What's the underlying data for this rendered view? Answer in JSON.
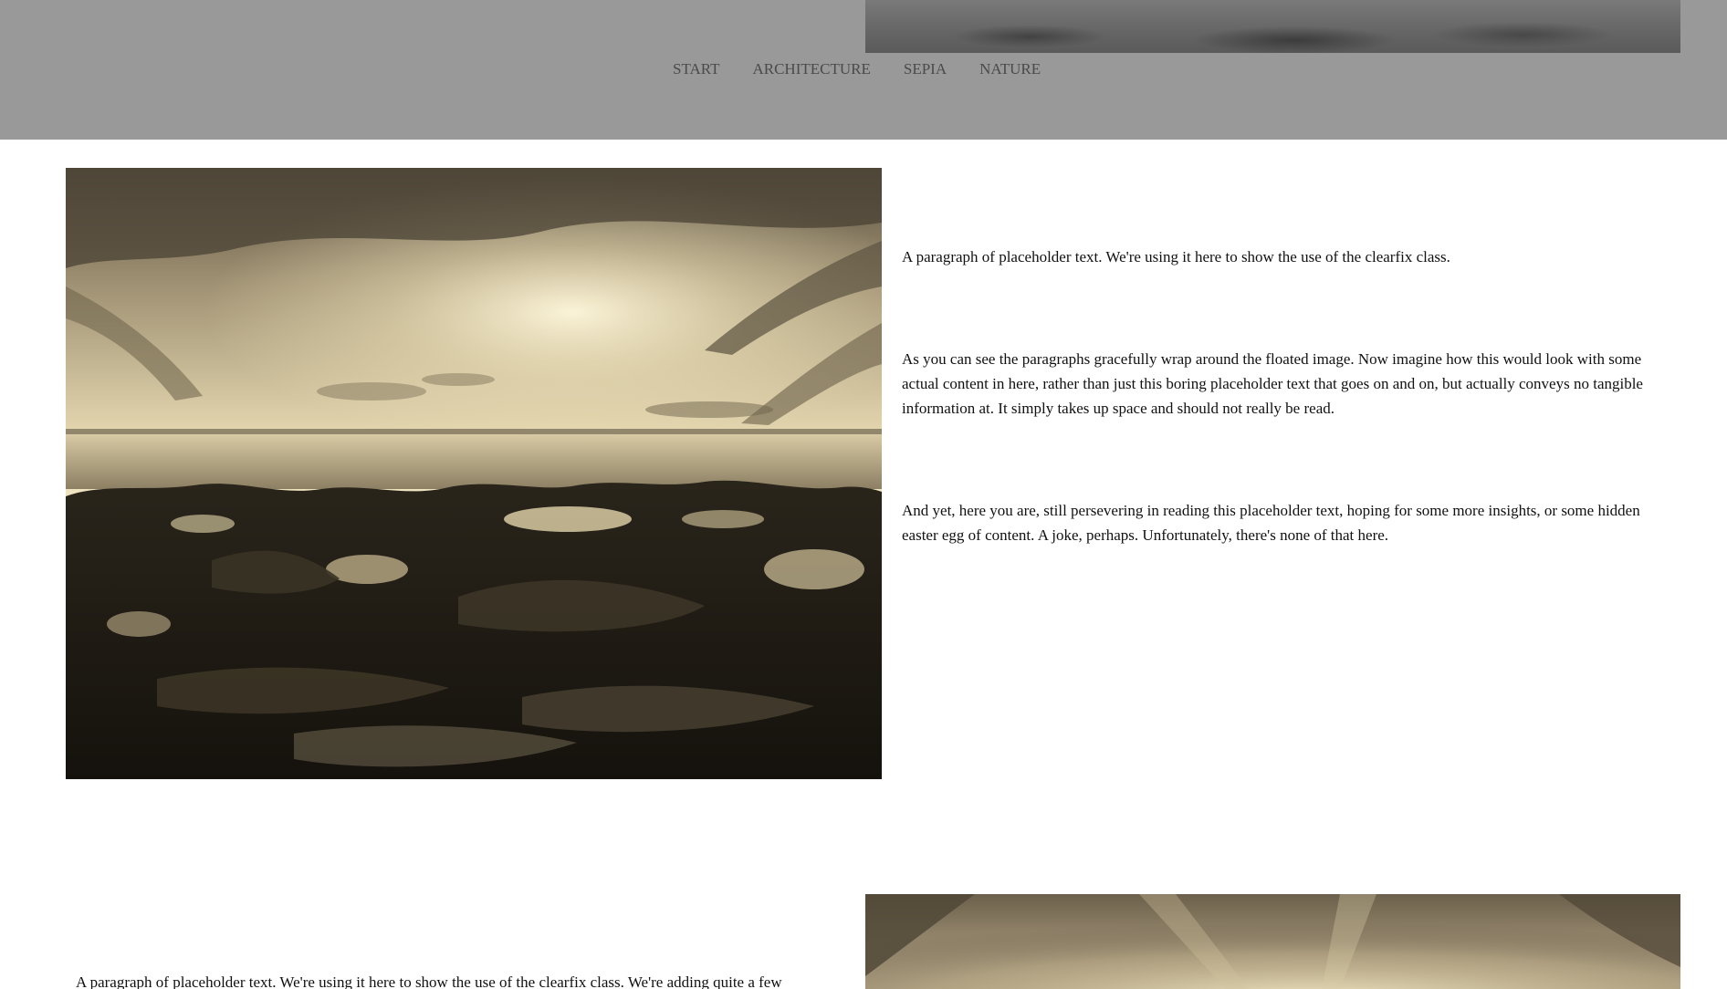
{
  "nav": {
    "items": [
      {
        "label": "START"
      },
      {
        "label": "ARCHITECTURE"
      },
      {
        "label": "SEPIA"
      },
      {
        "label": "NATURE"
      }
    ]
  },
  "colors": {
    "header_bg": "#999999",
    "nav_text": "#4a4a4a",
    "body_text": "#111111",
    "sepia_light": "#f3e8c4",
    "sepia_dark": "#1f1b14"
  },
  "section1": {
    "paragraphs": [
      "A paragraph of placeholder text. We're using it here to show the use of the clearfix class.",
      "As you can see the paragraphs gracefully wrap around the floated image. Now imagine how this would look with some actual content in here, rather than just this boring placeholder text that goes on and on, but actually conveys no tangible information at. It simply takes up space and should not really be read.",
      "And yet, here you are, still persevering in reading this placeholder text, hoping for some more insights, or some hidden easter egg of content. A joke, perhaps. Unfortunately, there's none of that here."
    ]
  },
  "section2": {
    "paragraph": "A paragraph of placeholder text. We're using it here to show the use of the clearfix class. We're adding quite a few"
  }
}
